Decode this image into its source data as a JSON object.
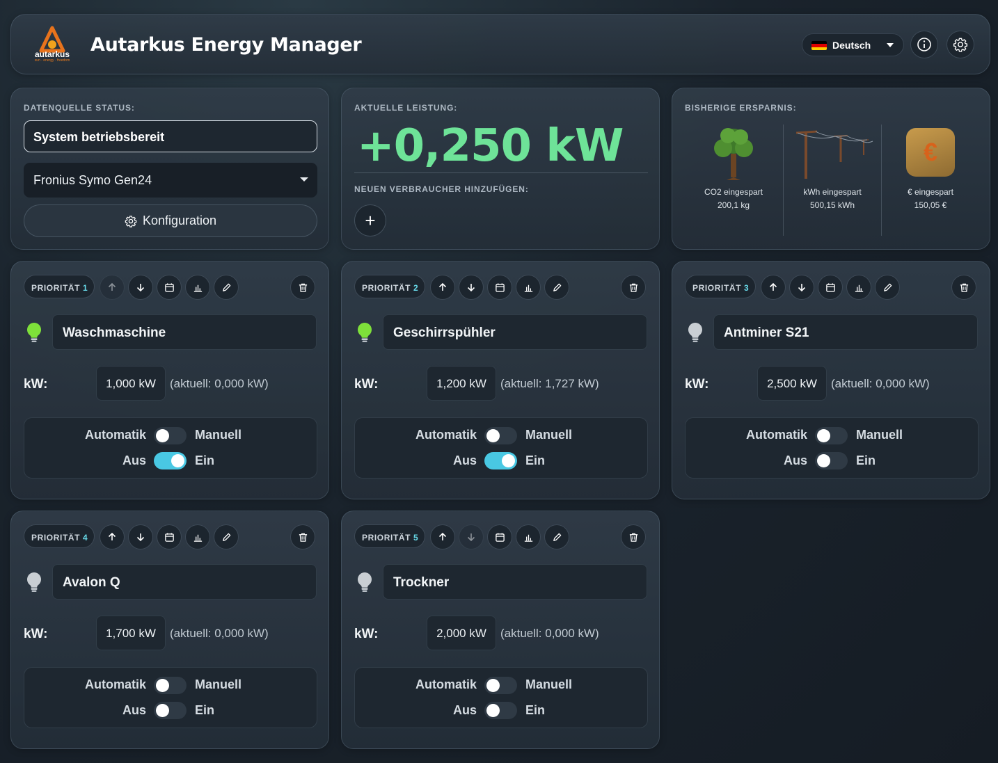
{
  "header": {
    "logo_text": "autarkus",
    "logo_sub": "sun · energy · freedom",
    "title": "Autarkus Energy Manager",
    "language": "Deutsch",
    "flag_colors": [
      "#000000",
      "#dd0000",
      "#ffce00"
    ]
  },
  "status_panel": {
    "label": "DATENQUELLE STATUS:",
    "status_text": "System betriebsbereit",
    "source_selected": "Fronius Symo Gen24",
    "config_button": "Konfiguration"
  },
  "power_panel": {
    "label": "AKTUELLE LEISTUNG:",
    "value": "+0,250 kW",
    "add_label": "NEUEN VERBRAUCHER HINZUFÜGEN:",
    "add_button": "+"
  },
  "savings_panel": {
    "label": "BISHERIGE ERSPARNIS:",
    "items": [
      {
        "icon": "tree-icon",
        "label": "CO2 eingespart",
        "value": "200,1 kg"
      },
      {
        "icon": "power-line-icon",
        "label": "kWh eingespart",
        "value": "500,15 kWh"
      },
      {
        "icon": "euro-icon",
        "symbol": "€",
        "label": "€ eingespart",
        "value": "150,05 €"
      }
    ]
  },
  "consumer_common": {
    "priority_label": "PRIORITÄT",
    "kw_label": "kW:",
    "automatic_label": "Automatik",
    "manual_label": "Manuell",
    "off_label": "Aus",
    "on_label": "Ein"
  },
  "consumers": [
    {
      "priority": "1",
      "name": "Waschmaschine",
      "kw": "1,000 kW",
      "current": "(aktuell: 0,000 kW)",
      "manual": false,
      "on": true,
      "bulb_active": true
    },
    {
      "priority": "2",
      "name": "Geschirrspühler",
      "kw": "1,200 kW",
      "current": "(aktuell: 1,727 kW)",
      "manual": false,
      "on": true,
      "bulb_active": true
    },
    {
      "priority": "3",
      "name": "Antminer S21",
      "kw": "2,500 kW",
      "current": "(aktuell: 0,000 kW)",
      "manual": false,
      "on": false,
      "bulb_active": false
    },
    {
      "priority": "4",
      "name": "Avalon Q",
      "kw": "1,700 kW",
      "current": "(aktuell: 0,000 kW)",
      "manual": false,
      "on": false,
      "bulb_active": false
    },
    {
      "priority": "5",
      "name": "Trockner",
      "kw": "2,000 kW",
      "current": "(aktuell: 0,000 kW)",
      "manual": false,
      "on": false,
      "bulb_active": false
    }
  ],
  "colors": {
    "accent_green": "#6ee398",
    "toggle_on": "#49c8e3",
    "bulb_on": "#7ee03a",
    "bulb_off": "#c9ced3"
  }
}
